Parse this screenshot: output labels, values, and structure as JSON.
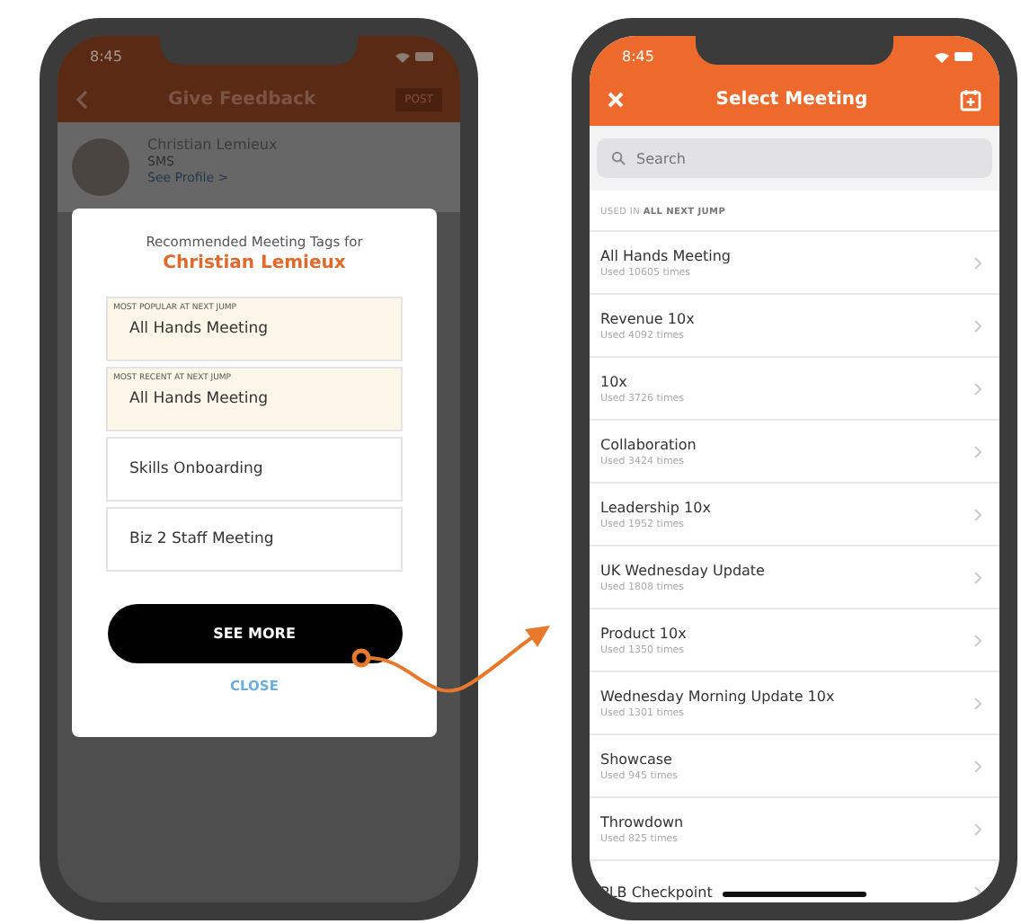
{
  "left_phone": {
    "status_bar": {
      "time": "8:45"
    },
    "nav_bar": {
      "title": "Give Feedback",
      "action": "POST"
    },
    "profile": {
      "name": "Christian Lemieux",
      "subtitle": "SMS",
      "link": "See Profile >"
    },
    "modal": {
      "heading": "Recommended Meeting Tags for",
      "person": "Christian Lemieux",
      "tags": [
        {
          "kind": "highlighted",
          "caption": "MOST POPULAR AT NEXT JUMP",
          "label": "All Hands Meeting"
        },
        {
          "kind": "highlighted",
          "caption": "MOST RECENT AT NEXT JUMP",
          "label": "All Hands Meeting"
        },
        {
          "kind": "plain",
          "label": "Skills Onboarding"
        },
        {
          "kind": "plain",
          "label": "Biz 2 Staff Meeting"
        }
      ],
      "primary_button": "SEE MORE",
      "close_button": "CLOSE"
    }
  },
  "right_phone": {
    "status_bar": {
      "time": "8:45"
    },
    "nav_bar": {
      "title": "Select Meeting"
    },
    "search": {
      "placeholder": "Search"
    },
    "section_label": "USED IN **ALL NEXT JUMP**",
    "meetings": [
      {
        "name": "All Hands Meeting",
        "usage": "Used 10605 times"
      },
      {
        "name": "Revenue 10x",
        "usage": "Used 4092 times"
      },
      {
        "name": "10x",
        "usage": "Used 3726 times"
      },
      {
        "name": "Collaboration",
        "usage": "Used 3424 times"
      },
      {
        "name": "Leadership 10x",
        "usage": "Used 1952 times"
      },
      {
        "name": "UK Wednesday Update",
        "usage": "Used 1808 times"
      },
      {
        "name": "Product 10x",
        "usage": "Used 1350 times"
      },
      {
        "name": "Wednesday Morning Update 10x",
        "usage": "Used 1301 times"
      },
      {
        "name": "Showcase",
        "usage": "Used 945 times"
      },
      {
        "name": "Throwdown",
        "usage": "Used 825 times"
      },
      {
        "name": "PLB Checkpoint"
      }
    ]
  }
}
